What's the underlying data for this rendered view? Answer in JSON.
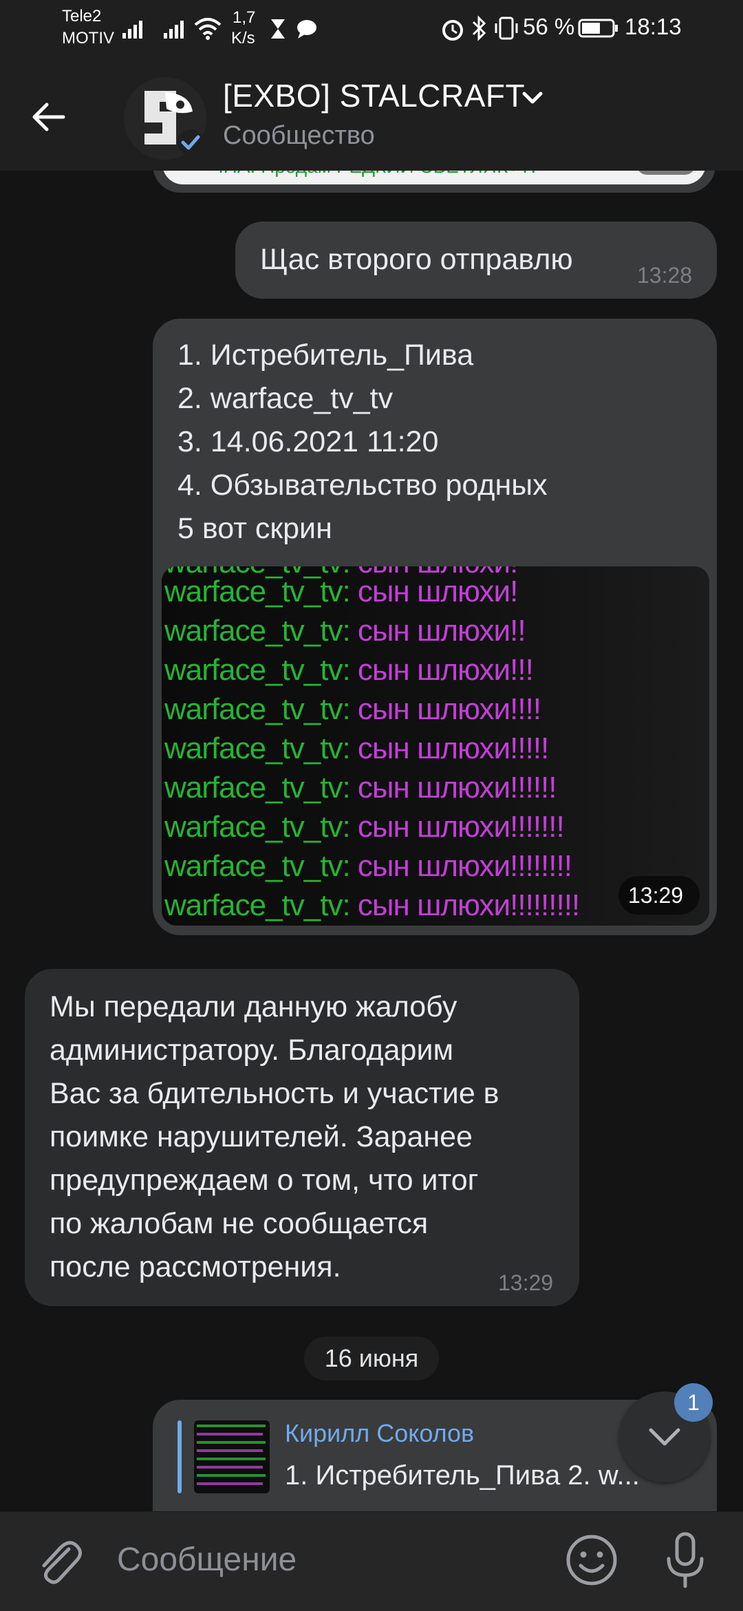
{
  "status_bar": {
    "carrier_line1": "Tele2",
    "carrier_line2": "MOTIV",
    "net_speed_value": "1,7",
    "net_speed_unit": "K/s",
    "battery": "56 %",
    "time": "18:13"
  },
  "header": {
    "title": "[EXBO] STALCRAFT",
    "subtitle": "Сообщество"
  },
  "prev_preview_text": "ЧНА. Продам РЕДКИЙ СВЕТЛЯК+ТР",
  "messages": {
    "m1": {
      "text": "Щас второго отправлю",
      "time": "13:28"
    },
    "m2": {
      "lines": [
        "1. Истребитель_Пива",
        "2. warface_tv_tv",
        "3. 14.06.2021 11:20",
        "4. Обзывательство родных",
        "5 вот скрин"
      ],
      "time": "13:29"
    },
    "screenshot": {
      "nick": "warface_tv_tv:",
      "lines": [
        "сын шлюхи!",
        "сын шлюхи!!",
        "сын шлюхи!!!",
        "сын шлюхи!!!!",
        "сын шлюхи!!!!!",
        "сын шлюхи!!!!!!",
        "сын шлюхи!!!!!!!",
        "сын шлюхи!!!!!!!!",
        "сын шлюхи!!!!!!!!!"
      ]
    },
    "m3": {
      "lines": [
        "Мы передали данную жалобу",
        "администратору. Благодарим",
        "Вас за бдительность и участие в",
        "поимке нарушителей. Заранее",
        "предупреждаем о том, что итог",
        "по жалобам не сообщается",
        "после рассмотрения."
      ],
      "time": "13:29"
    }
  },
  "date_separator": "16 июня",
  "reply": {
    "author": "Кирилл Соколов",
    "preview": "1. Истребитель_Пива 2. w..."
  },
  "scroll_badge": "1",
  "composer": {
    "placeholder": "Сообщение"
  },
  "colors": {
    "accent": "#71aaeb",
    "badge": "#5181b8",
    "nick": "#25b532",
    "msg": "#c23fd6"
  }
}
